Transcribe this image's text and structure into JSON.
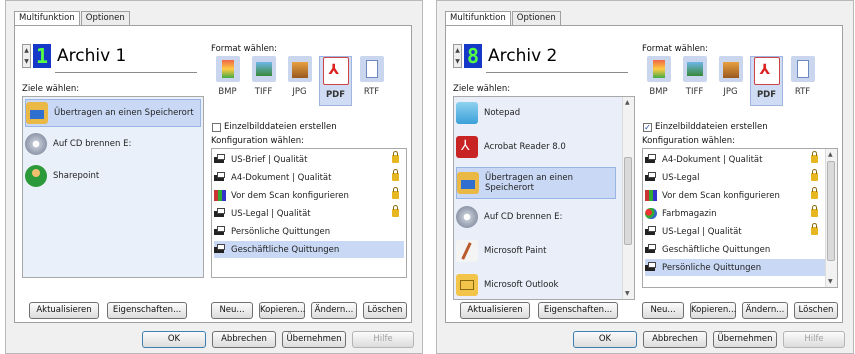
{
  "tabs": [
    "Multifunktion",
    "Optionen"
  ],
  "labels": {
    "destinations": "Ziele wählen:",
    "format": "Format wählen:",
    "configuration": "Konfiguration wählen:",
    "single_images": "Einzelbilddateien erstellen"
  },
  "formats": [
    "BMP",
    "TIFF",
    "JPG",
    "PDF",
    "RTF"
  ],
  "buttons": {
    "update": "Aktualisieren",
    "properties": "Eigenschaften...",
    "new": "Neu...",
    "copy": "Kopieren...",
    "change": "Ändern...",
    "delete": "Löschen",
    "ok": "OK",
    "cancel": "Abbrechen",
    "apply": "Übernehmen",
    "help": "Hilfe"
  },
  "left": {
    "number": "1",
    "name": "Archiv 1",
    "selected_format": "PDF",
    "single_images_checked": false,
    "destinations": [
      "Übertragen an einen Speicherort",
      "Auf CD brennen  E:",
      "Sharepoint"
    ],
    "configs": [
      {
        "label": "US-Brief | Qualität",
        "locked": true
      },
      {
        "label": "A4-Dokument | Qualität",
        "locked": true
      },
      {
        "label": "Vor dem Scan konfigurieren",
        "locked": true
      },
      {
        "label": "US-Legal | Qualität",
        "locked": true
      },
      {
        "label": "Persönliche Quittungen",
        "locked": false
      },
      {
        "label": "Geschäftliche Quittungen",
        "locked": false
      }
    ]
  },
  "right": {
    "number": "8",
    "name": "Archiv 2",
    "selected_format": "PDF",
    "single_images_checked": true,
    "destinations": [
      "Notepad",
      "Acrobat Reader 8.0",
      "Übertragen an einen Speicherort",
      "Auf CD brennen  E:",
      "Microsoft Paint",
      "Microsoft Outlook"
    ],
    "configs": [
      {
        "label": "A4-Dokument | Qualität",
        "locked": true
      },
      {
        "label": "US-Legal",
        "locked": true
      },
      {
        "label": "Vor dem Scan konfigurieren",
        "locked": true
      },
      {
        "label": "Farbmagazin",
        "locked": true
      },
      {
        "label": "US-Legal | Qualität",
        "locked": true
      },
      {
        "label": "Geschäftliche Quittungen",
        "locked": false
      },
      {
        "label": "Persönliche Quittungen",
        "locked": false
      }
    ]
  },
  "colors": {
    "digit_bg": "#1638c8",
    "digit_fg": "#54ff44",
    "selection": "#c9d9f5",
    "lock": "#e7b722"
  }
}
